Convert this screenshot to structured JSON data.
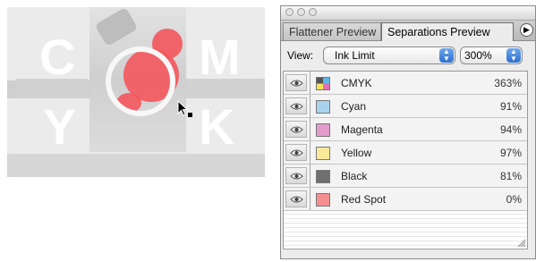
{
  "artwork": {
    "letters": [
      "C",
      "M",
      "Y",
      "K"
    ]
  },
  "panel": {
    "tabs": [
      {
        "label": "Flattener Preview",
        "active": false
      },
      {
        "label": "Separations Preview",
        "active": true
      }
    ],
    "view_label": "View:",
    "view_value": "Ink Limit",
    "ink_limit_value": "300%",
    "separations": [
      {
        "name": "CMYK",
        "value": "363%",
        "color": "cmyk"
      },
      {
        "name": "Cyan",
        "value": "91%",
        "color": "#a9d3ec"
      },
      {
        "name": "Magenta",
        "value": "94%",
        "color": "#e39bcc"
      },
      {
        "name": "Yellow",
        "value": "97%",
        "color": "#fbe99a"
      },
      {
        "name": "Black",
        "value": "81%",
        "color": "#6f6f6f"
      },
      {
        "name": "Red Spot",
        "value": "0%",
        "color": "#f58f8f"
      }
    ],
    "colors": {
      "highlight": "#f2595e",
      "selector_blue": "#2e6fd0"
    }
  }
}
